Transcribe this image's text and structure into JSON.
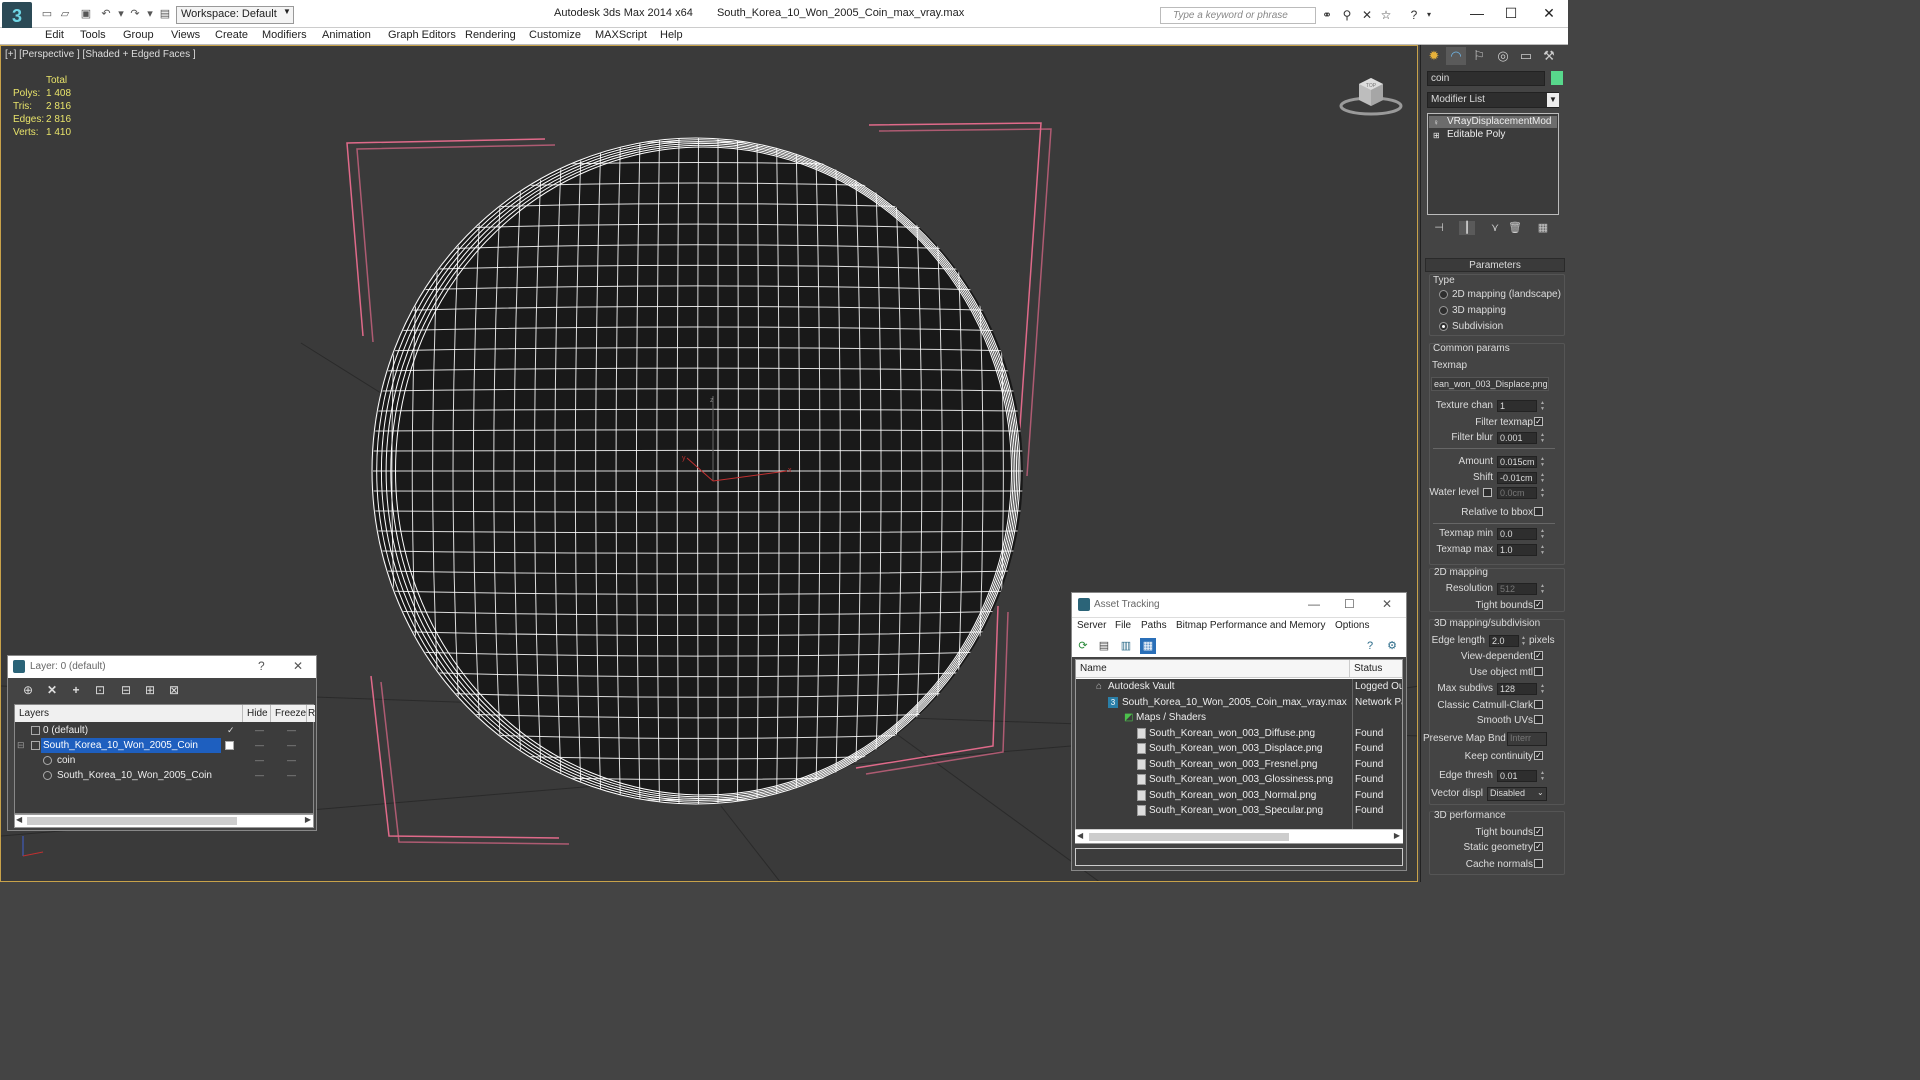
{
  "titlebar": {
    "workspace": "Workspace: Default",
    "app_name": "Autodesk 3ds Max  2014 x64",
    "file_name": "South_Korea_10_Won_2005_Coin_max_vray.max",
    "search_placeholder": "Type a keyword or phrase"
  },
  "menu": [
    "Edit",
    "Tools",
    "Group",
    "Views",
    "Create",
    "Modifiers",
    "Animation",
    "Graph Editors",
    "Rendering",
    "Customize",
    "MAXScript",
    "Help"
  ],
  "viewport": {
    "label": "[+] [Perspective ] [Shaded + Edged Faces ]",
    "stats_header": "Total",
    "stats": [
      {
        "label": "Polys:",
        "value": "1 408"
      },
      {
        "label": "Tris:",
        "value": "2 816"
      },
      {
        "label": "Edges:",
        "value": "2 816"
      },
      {
        "label": "Verts:",
        "value": "1 410"
      }
    ],
    "viewcube_label": "TOP",
    "gizmo_x": "x",
    "gizmo_y": "y",
    "gizmo_z": "z",
    "colors": {
      "background": "#3a3a3a",
      "mesh_fill": "#191919",
      "wire": "#ffffff",
      "bracket": "#e06a8a",
      "grid": "#2a2a2a",
      "border": "#c8a24a"
    }
  },
  "command_panel": {
    "object_name": "coin",
    "object_color": "#58d88c",
    "modifier_list": "Modifier List",
    "stack": [
      "VRayDisplacementMod",
      "Editable Poly"
    ],
    "parameters_title": "Parameters",
    "type_label": "Type",
    "type_options": [
      {
        "label": "2D mapping (landscape)",
        "selected": false
      },
      {
        "label": "3D mapping",
        "selected": false
      },
      {
        "label": "Subdivision",
        "selected": true
      }
    ],
    "common_params_label": "Common params",
    "texmap_label": "Texmap",
    "texmap_value": "ean_won_003_Displace.png)",
    "texture_chan_label": "Texture chan",
    "texture_chan_value": "1",
    "filter_texmap_label": "Filter texmap",
    "filter_texmap": true,
    "filter_blur_label": "Filter blur",
    "filter_blur_value": "0.001",
    "amount_label": "Amount",
    "amount_value": "0.015cm",
    "shift_label": "Shift",
    "shift_value": "-0.01cm",
    "water_level_label": "Water level",
    "water_level_value": "0.0cm",
    "relative_bbox_label": "Relative to bbox",
    "texmap_min_label": "Texmap min",
    "texmap_min_value": "0.0",
    "texmap_max_label": "Texmap max",
    "texmap_max_value": "1.0",
    "mapping2d_label": "2D mapping",
    "resolution_label": "Resolution",
    "resolution_value": "512",
    "tight_bounds_label": "Tight bounds",
    "mapping3d_label": "3D mapping/subdivision",
    "edge_length_label": "Edge length",
    "edge_length_value": "2.0",
    "pixels_label": "pixels",
    "view_dependent_label": "View-dependent",
    "use_object_mtl_label": "Use object mtl",
    "max_subdivs_label": "Max subdivs",
    "max_subdivs_value": "128",
    "catmull_label": "Classic Catmull-Clark",
    "smooth_uvs_label": "Smooth UVs",
    "preserve_map_label": "Preserve Map Bnd",
    "preserve_map_value": "Interr",
    "keep_continuity_label": "Keep continuity",
    "edge_thresh_label": "Edge thresh",
    "edge_thresh_value": "0.01",
    "vector_disp_label": "Vector displ",
    "vector_disp_value": "Disabled",
    "performance_label": "3D performance",
    "perf_tight_bounds_label": "Tight bounds",
    "static_geometry_label": "Static geometry",
    "cache_normals_label": "Cache normals"
  },
  "layer_dialog": {
    "title": "Layer: 0 (default)",
    "help": "?",
    "close": "✕",
    "headers": {
      "layers": "Layers",
      "hide": "Hide",
      "freeze": "Freeze",
      "render": "R"
    },
    "rows": [
      {
        "name": "0 (default)",
        "indent": 1
      },
      {
        "name": "South_Korea_10_Won_2005_Coin",
        "indent": 1
      },
      {
        "name": "coin",
        "indent": 2
      },
      {
        "name": "South_Korea_10_Won_2005_Coin",
        "indent": 2
      }
    ]
  },
  "asset_dialog": {
    "title": "Asset Tracking",
    "menu": [
      "Server",
      "File",
      "Paths",
      "Bitmap Performance and Memory",
      "Options"
    ],
    "headers": {
      "name": "Name",
      "status": "Status"
    },
    "rows": [
      {
        "name": "Autodesk Vault",
        "status": "Logged Ou",
        "indent": 1
      },
      {
        "name": "South_Korea_10_Won_2005_Coin_max_vray.max",
        "status": "Network Pa",
        "indent": 2
      },
      {
        "name": "Maps / Shaders",
        "status": "",
        "indent": 3
      },
      {
        "name": "South_Korean_won_003_Diffuse.png",
        "status": "Found",
        "indent": 4
      },
      {
        "name": "South_Korean_won_003_Displace.png",
        "status": "Found",
        "indent": 4
      },
      {
        "name": "South_Korean_won_003_Fresnel.png",
        "status": "Found",
        "indent": 4
      },
      {
        "name": "South_Korean_won_003_Glossiness.png",
        "status": "Found",
        "indent": 4
      },
      {
        "name": "South_Korean_won_003_Normal.png",
        "status": "Found",
        "indent": 4
      },
      {
        "name": "South_Korean_won_003_Specular.png",
        "status": "Found",
        "indent": 4
      }
    ]
  }
}
